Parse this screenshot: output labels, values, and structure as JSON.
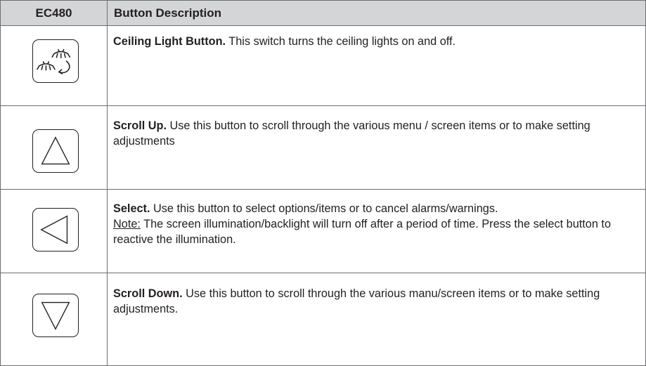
{
  "table": {
    "header": {
      "col1": "EC480",
      "col2": "Button Description"
    },
    "rows": [
      {
        "icon": "ceiling-light-icon",
        "title": "Ceiling Light Button.",
        "text": " This switch turns the ceiling lights on and off."
      },
      {
        "icon": "triangle-up-icon",
        "title": "Scroll Up.",
        "text": " Use this button to scroll through the various menu / screen items or to make setting adjustments"
      },
      {
        "icon": "triangle-left-icon",
        "title": "Select.",
        "text": " Use this button to select options/items or to cancel alarms/warnings.",
        "note_label": "Note:",
        "note_text": " The screen illumination/backlight will turn off after a period of time. Press the select button to reactive the illumination."
      },
      {
        "icon": "triangle-down-icon",
        "title": "Scroll Down.",
        "text": " Use this button to scroll through the various manu/screen items or to make setting adjustments."
      }
    ]
  },
  "colors": {
    "header_bg": "#d4d5d7",
    "rule": "#6d6e71",
    "text": "#231f20"
  }
}
